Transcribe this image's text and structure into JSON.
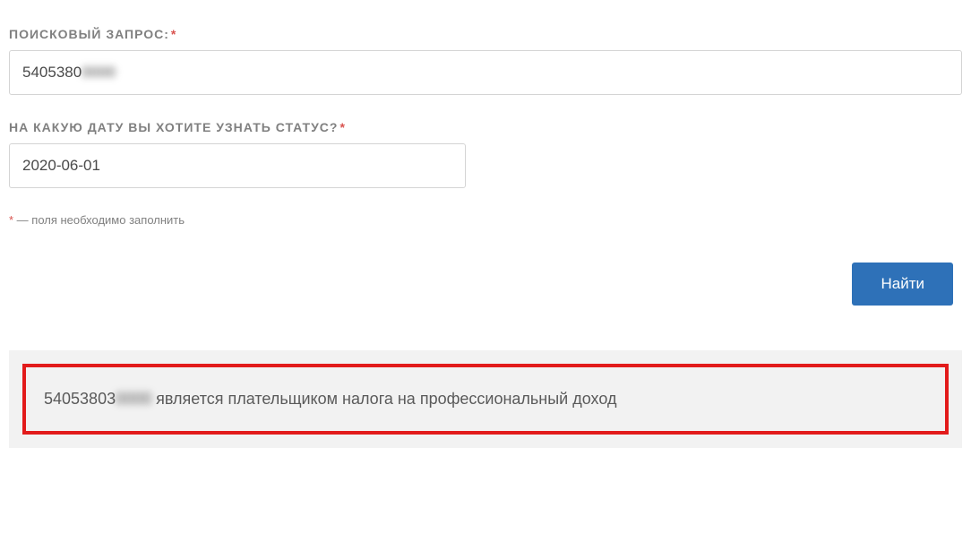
{
  "form": {
    "search": {
      "label": "ПОИСКОВЫЙ ЗАПРОС:",
      "value_prefix": "5405380",
      "value_blurred": "0000"
    },
    "date": {
      "label": "НА КАКУЮ ДАТУ ВЫ ХОТИТЕ УЗНАТЬ СТАТУС?",
      "value": "2020-06-01"
    },
    "required_hint": " — поля необходимо заполнить",
    "submit_label": "Найти"
  },
  "result": {
    "id_prefix": "54053803",
    "id_blurred": "0000",
    "text": " является плательщиком налога на профессиональный доход"
  }
}
